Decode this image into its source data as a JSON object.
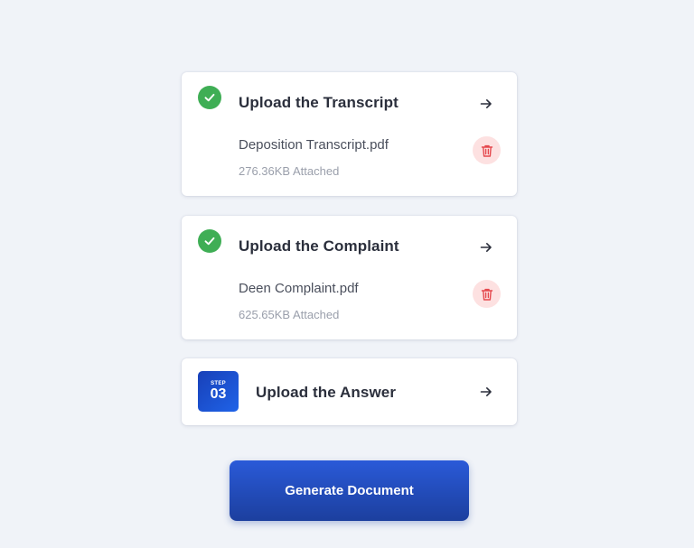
{
  "steps": [
    {
      "title": "Upload the Transcript",
      "status": "complete",
      "file": {
        "name": "Deposition Transcript.pdf",
        "size_text": "276.36KB Attached"
      }
    },
    {
      "title": "Upload the Complaint",
      "status": "complete",
      "file": {
        "name": "Deen Complaint.pdf",
        "size_text": "625.65KB Attached"
      }
    },
    {
      "title": "Upload the Answer",
      "status": "pending",
      "badge": {
        "word": "STEP",
        "number": "03"
      }
    }
  ],
  "actions": {
    "generate_label": "Generate Document"
  },
  "icons": {
    "complete": "check-icon",
    "open": "arrow-right-icon",
    "remove": "trash-icon"
  },
  "colors": {
    "background": "#f0f3f8",
    "success": "#3fae55",
    "danger": "#e5484d",
    "danger_bg": "#fde1e1",
    "primary": "#2a5ad8",
    "primary_dark": "#1c3f9e"
  }
}
